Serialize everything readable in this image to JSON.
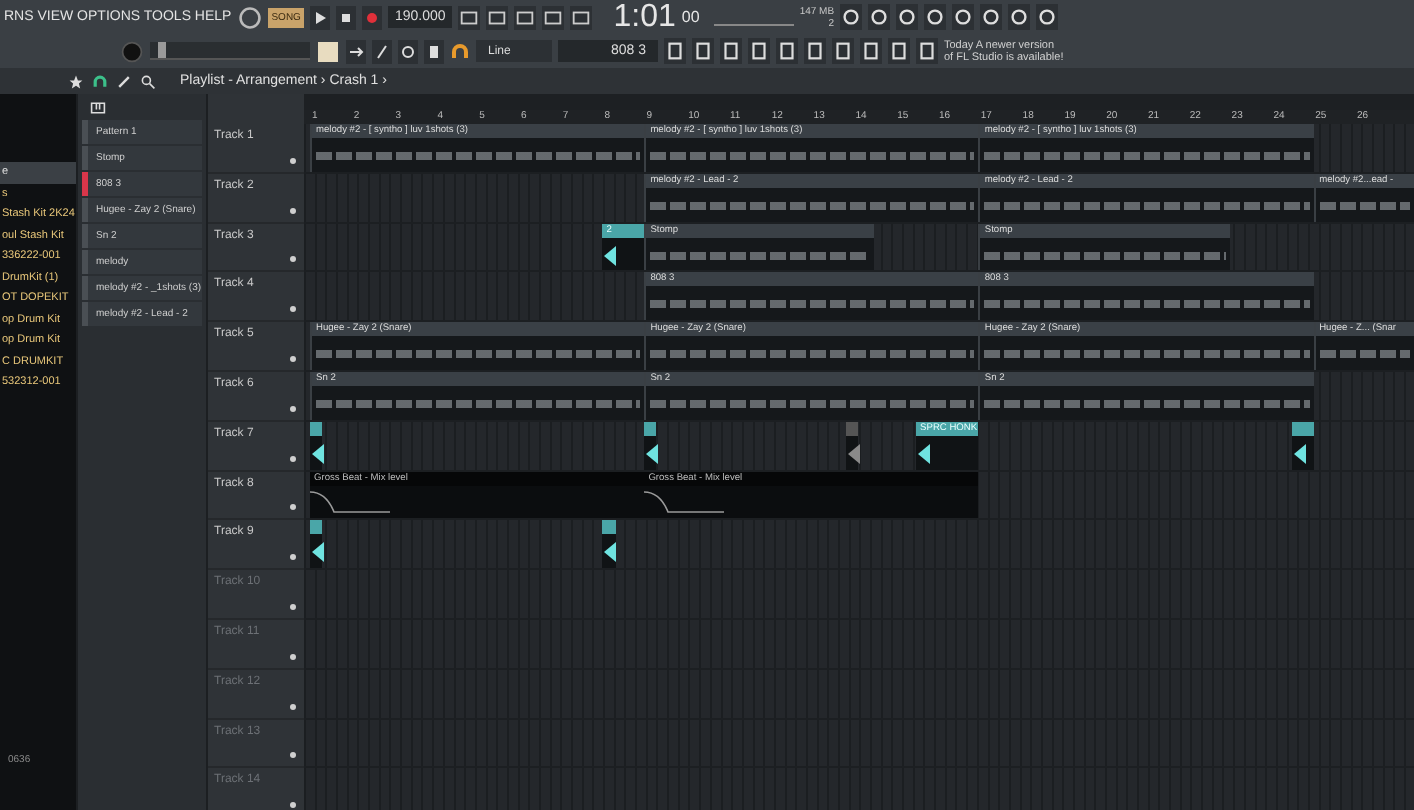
{
  "menu": {
    "text": "RNS VIEW OPTIONS TOOLS HELP"
  },
  "transport": {
    "mode_label": "SONG",
    "tempo": "190.000",
    "time": "1:01",
    "time_sub": "00",
    "memory": "147 MB",
    "polyphony": "2"
  },
  "toolbar": {
    "snap": "Line",
    "pattern": "808 3",
    "hint": "Today  A newer version of FL Studio is available!"
  },
  "master_pitch": {
    "level": 0.05
  },
  "playlist": {
    "title": "Playlist - Arrangement › Crash 1 ›"
  },
  "browser": {
    "items": [
      {
        "label": "e",
        "selected": true
      },
      {
        "label": "s",
        "selected": false
      },
      {
        "label": "Stash Kit 2K24",
        "selected": false
      },
      {
        "label": "oul Stash Kit",
        "selected": false
      },
      {
        "label": "336222-001",
        "selected": false
      },
      {
        "label": "DrumKit (1)",
        "selected": false
      },
      {
        "label": "OT DOPEKIT",
        "selected": false
      },
      {
        "label": "op Drum Kit",
        "selected": false
      },
      {
        "label": "op Drum Kit",
        "selected": false
      },
      {
        "label": "C DRUMKIT",
        "selected": false
      },
      {
        "label": "532312-001",
        "selected": false
      }
    ],
    "footer": "0636"
  },
  "patterns": [
    {
      "label": "Pattern 1",
      "selected": false
    },
    {
      "label": "Stomp",
      "selected": false
    },
    {
      "label": "808 3",
      "selected": true
    },
    {
      "label": "Hugee - Zay 2 (Snare)",
      "selected": false
    },
    {
      "label": "Sn 2",
      "selected": false
    },
    {
      "label": "melody",
      "selected": false
    },
    {
      "label": "melody #2 - _1shots (3)",
      "selected": false
    },
    {
      "label": "melody #2 - Lead - 2",
      "selected": false
    }
  ],
  "ruler": [
    "1",
    "2",
    "3",
    "4",
    "5",
    "6",
    "7",
    "8",
    "9",
    "10",
    "11",
    "12",
    "13",
    "14",
    "15",
    "16",
    "17",
    "18",
    "19",
    "20",
    "21",
    "22",
    "23",
    "24",
    "25",
    "26"
  ],
  "tracks": [
    {
      "name": "Track 1",
      "dimmed": false,
      "clips": [
        {
          "kind": "pattern",
          "label": "melody #2 - [ syntho ] luv 1shots (3)"
        },
        {
          "kind": "pattern",
          "label": "melody #2 - [ syntho ] luv 1shots (3)"
        },
        {
          "kind": "pattern",
          "label": "melody #2 - [ syntho ] luv 1shots (3)"
        }
      ]
    },
    {
      "name": "Track 2",
      "dimmed": false,
      "clips": [
        {
          "kind": "pattern",
          "label": "melody #2 - Lead - 2"
        },
        {
          "kind": "pattern",
          "label": "melody #2 - Lead - 2"
        },
        {
          "kind": "pattern",
          "label": "melody #2...ead -"
        }
      ]
    },
    {
      "name": "Track 3",
      "dimmed": false,
      "clips": [
        {
          "kind": "audio",
          "label": "2"
        },
        {
          "kind": "pattern",
          "label": "Stomp"
        },
        {
          "kind": "pattern",
          "label": "Stomp"
        }
      ]
    },
    {
      "name": "Track 4",
      "dimmed": false,
      "clips": [
        {
          "kind": "pattern",
          "label": "808 3"
        },
        {
          "kind": "pattern",
          "label": "808 3"
        }
      ]
    },
    {
      "name": "Track 5",
      "dimmed": false,
      "clips": [
        {
          "kind": "pattern",
          "label": "Hugee - Zay 2 (Snare)"
        },
        {
          "kind": "pattern",
          "label": "Hugee - Zay 2 (Snare)"
        },
        {
          "kind": "pattern",
          "label": "Hugee - Zay 2 (Snare)"
        },
        {
          "kind": "pattern",
          "label": "Hugee - Z... (Snar"
        }
      ]
    },
    {
      "name": "Track 6",
      "dimmed": false,
      "clips": [
        {
          "kind": "pattern",
          "label": "Sn 2"
        },
        {
          "kind": "pattern",
          "label": "Sn 2"
        },
        {
          "kind": "pattern",
          "label": "Sn 2"
        }
      ]
    },
    {
      "name": "Track 7",
      "dimmed": false,
      "clips": [
        {
          "kind": "audio"
        },
        {
          "kind": "audio"
        },
        {
          "kind": "audio-muted"
        },
        {
          "kind": "audio",
          "label": "SPRC HONK"
        },
        {
          "kind": "audio"
        }
      ]
    },
    {
      "name": "Track 8",
      "dimmed": false,
      "clips": [
        {
          "kind": "automation",
          "label": "Gross Beat - Mix level"
        },
        {
          "kind": "automation",
          "label": "Gross Beat - Mix level"
        }
      ]
    },
    {
      "name": "Track 9",
      "dimmed": false,
      "clips": [
        {
          "kind": "audio"
        },
        {
          "kind": "audio"
        }
      ]
    },
    {
      "name": "Track 10",
      "dimmed": true
    },
    {
      "name": "Track 11",
      "dimmed": true
    },
    {
      "name": "Track 12",
      "dimmed": true
    },
    {
      "name": "Track 13",
      "dimmed": true
    },
    {
      "name": "Track 14",
      "dimmed": true
    }
  ]
}
